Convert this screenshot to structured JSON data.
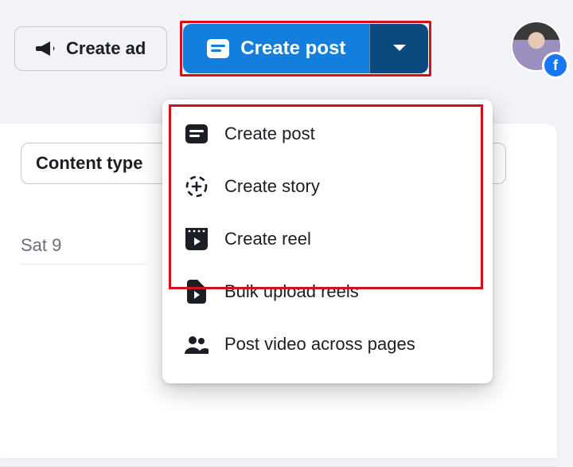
{
  "topbar": {
    "create_ad_label": "Create ad",
    "create_post_label": "Create post"
  },
  "content": {
    "content_type_label": "Content type",
    "day_label": "Sat 9"
  },
  "dropdown": {
    "items": [
      {
        "label": "Create post"
      },
      {
        "label": "Create story"
      },
      {
        "label": "Create reel"
      },
      {
        "label": "Bulk upload reels"
      },
      {
        "label": "Post video across pages"
      }
    ]
  },
  "avatar": {
    "platform_badge": "f"
  }
}
